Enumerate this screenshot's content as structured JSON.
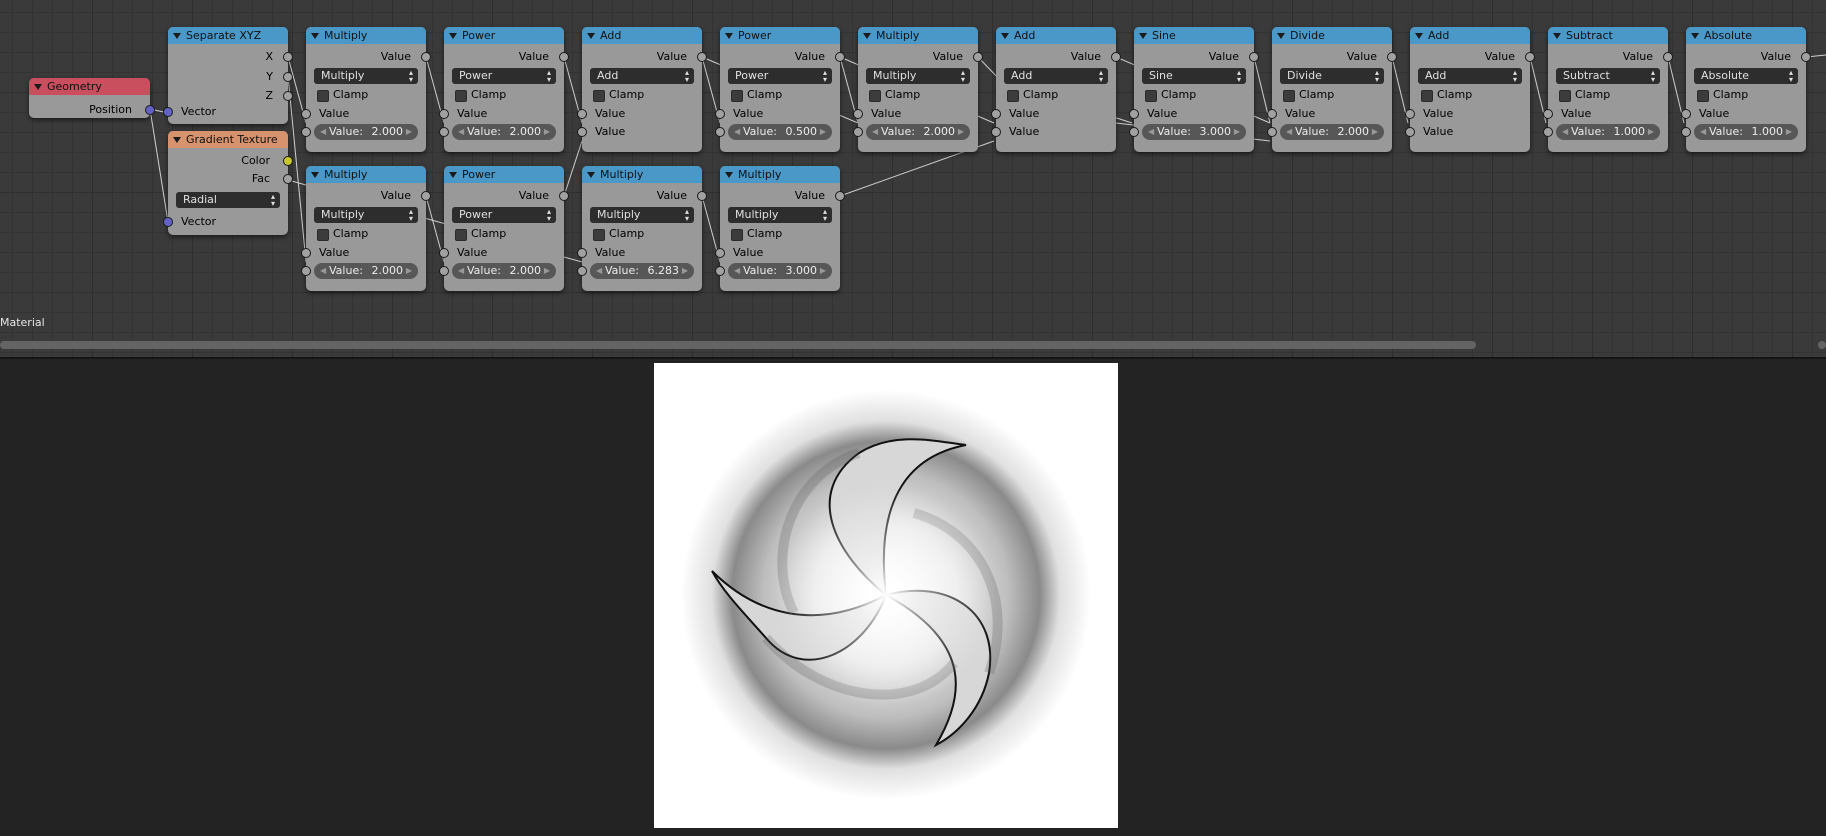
{
  "editor_label": "Material",
  "nodes": {
    "geometry": {
      "title": "Geometry",
      "output": "Position"
    },
    "separate": {
      "title": "Separate XYZ",
      "out_x": "X",
      "out_y": "Y",
      "out_z": "Z",
      "input": "Vector"
    },
    "gradient": {
      "title": "Gradient Texture",
      "out_color": "Color",
      "out_fac": "Fac",
      "type": "Radial",
      "input": "Vector"
    },
    "m1": {
      "title": "Multiply",
      "output": "Value",
      "op": "Multiply",
      "clamp": "Clamp",
      "in1": "Value",
      "in2_label": "Value:",
      "in2_value": "2.000"
    },
    "p1": {
      "title": "Power",
      "output": "Value",
      "op": "Power",
      "clamp": "Clamp",
      "in1": "Value",
      "in2_label": "Value:",
      "in2_value": "2.000"
    },
    "a1": {
      "title": "Add",
      "output": "Value",
      "op": "Add",
      "clamp": "Clamp",
      "in1": "Value",
      "in2": "Value"
    },
    "p2": {
      "title": "Power",
      "output": "Value",
      "op": "Power",
      "clamp": "Clamp",
      "in1": "Value",
      "in2_label": "Value:",
      "in2_value": "0.500"
    },
    "m2": {
      "title": "Multiply",
      "output": "Value",
      "op": "Multiply",
      "clamp": "Clamp",
      "in1": "Value",
      "in2_label": "Value:",
      "in2_value": "2.000"
    },
    "a2": {
      "title": "Add",
      "output": "Value",
      "op": "Add",
      "clamp": "Clamp",
      "in1": "Value",
      "in2": "Value"
    },
    "s1": {
      "title": "Sine",
      "output": "Value",
      "op": "Sine",
      "clamp": "Clamp",
      "in1": "Value",
      "in2_label": "Value:",
      "in2_value": "3.000"
    },
    "d1": {
      "title": "Divide",
      "output": "Value",
      "op": "Divide",
      "clamp": "Clamp",
      "in1": "Value",
      "in2_label": "Value:",
      "in2_value": "2.000"
    },
    "a3": {
      "title": "Add",
      "output": "Value",
      "op": "Add",
      "clamp": "Clamp",
      "in1": "Value",
      "in2": "Value"
    },
    "sub": {
      "title": "Subtract",
      "output": "Value",
      "op": "Subtract",
      "clamp": "Clamp",
      "in1": "Value",
      "in2_label": "Value:",
      "in2_value": "1.000"
    },
    "abs": {
      "title": "Absolute",
      "output": "Value",
      "op": "Absolute",
      "clamp": "Clamp",
      "in1": "Value",
      "in2_label": "Value:",
      "in2_value": "1.000"
    },
    "m3": {
      "title": "Multiply",
      "output": "Value",
      "op": "Multiply",
      "clamp": "Clamp",
      "in1": "Value",
      "in2_label": "Value:",
      "in2_value": "2.000"
    },
    "p3": {
      "title": "Power",
      "output": "Value",
      "op": "Power",
      "clamp": "Clamp",
      "in1": "Value",
      "in2_label": "Value:",
      "in2_value": "2.000"
    },
    "m4": {
      "title": "Multiply",
      "output": "Value",
      "op": "Multiply",
      "clamp": "Clamp",
      "in1": "Value",
      "in2_label": "Value:",
      "in2_value": "6.283"
    },
    "m5": {
      "title": "Multiply",
      "output": "Value",
      "op": "Multiply",
      "clamp": "Clamp",
      "in1": "Value",
      "in2_label": "Value:",
      "in2_value": "3.000"
    }
  },
  "colors": {
    "math_header": "#4a98c8",
    "geometry_header": "#c94e5e",
    "texture_header": "#d6936e",
    "node_body": "#999999",
    "editor_bg": "#3a3a3a"
  }
}
